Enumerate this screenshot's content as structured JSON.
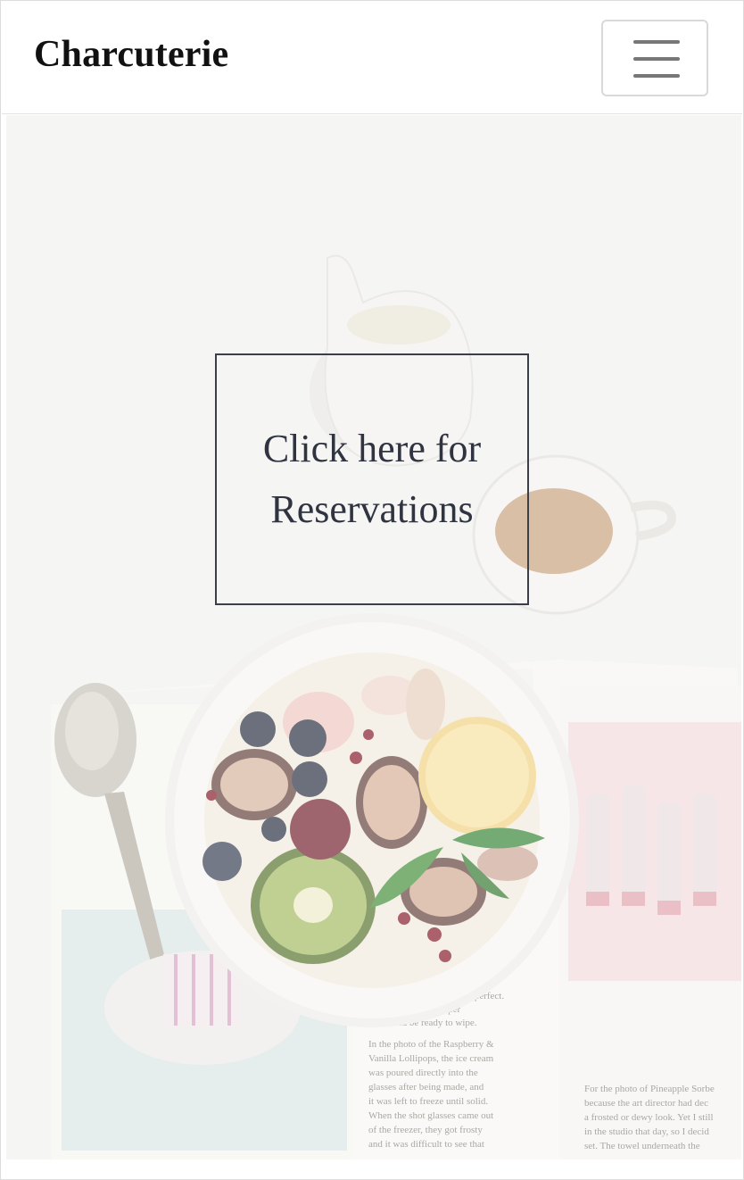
{
  "navbar": {
    "brand": "Charcuterie",
    "toggle_icon": "hamburger-menu-icon"
  },
  "hero": {
    "image_description_icon": "breakfast-bowl-photo",
    "cta_label": "Click here for Reservations"
  },
  "magazine": {
    "left_page_text": [
      "; it",
      "then it's perfect.",
      "itself with a paper",
      "towel and be ready to wipe.",
      "In the photo of the Raspberry &",
      "Vanilla Lollipops, the ice cream",
      "was poured directly into the",
      "glasses after being made, and",
      "it was left to freeze until solid.",
      "When the shot glasses came out",
      "of the freezer, they got frosty",
      "and it was difficult to see that"
    ],
    "right_page_text": [
      "For the photo of Pineapple Sorbe",
      "because the art director had dec",
      "a frosted or dewy look. Yet I still",
      "in the studio that day, so I decid",
      "set. The towel underneath the"
    ]
  },
  "colors": {
    "brand_text": "#111111",
    "cta_border": "#3a3f4a",
    "cta_text": "#2f3440",
    "toggler_border": "#d9d9d9"
  }
}
